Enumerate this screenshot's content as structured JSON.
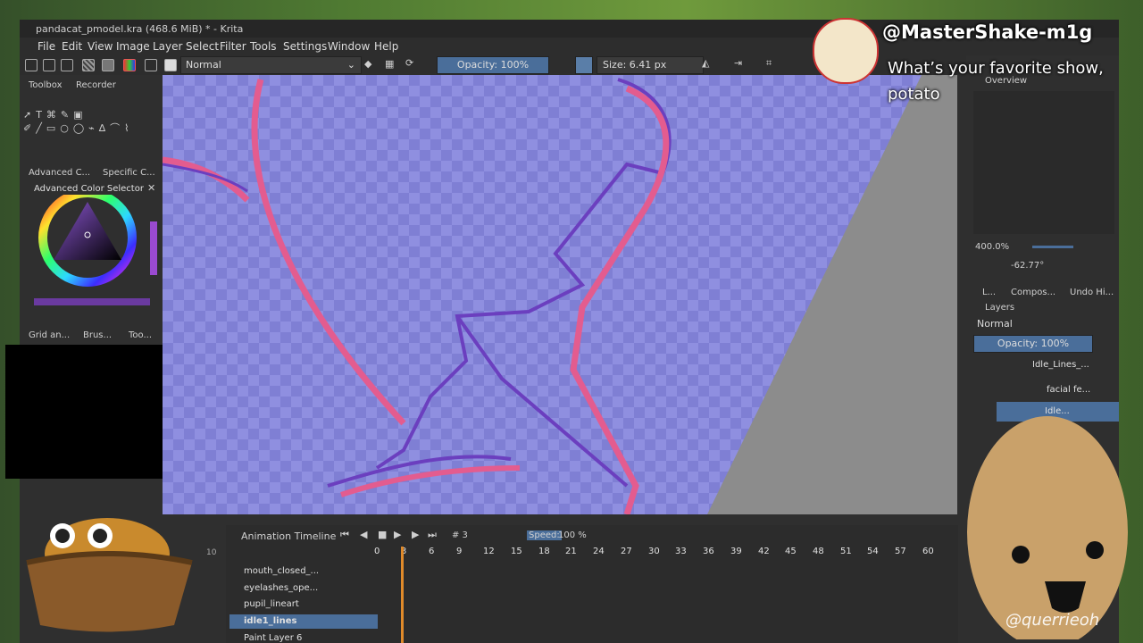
{
  "window": {
    "title": "pandacat_pmodel.kra (468.6 MiB) * - Krita"
  },
  "menu": [
    "File",
    "Edit",
    "View",
    "Image",
    "Layer",
    "Select",
    "Filter",
    "Tools",
    "Settings",
    "Window",
    "Help"
  ],
  "toolbar": {
    "blend_mode": "Normal",
    "opacity_label": "Opacity: 100%",
    "size_label": "Size: 6.41 px"
  },
  "left_dock": {
    "tabs": [
      "Toolbox",
      "Recorder"
    ],
    "color_tabs": [
      "Advanced C...",
      "Specific C..."
    ],
    "color_selector_title": "Advanced Color Selector",
    "bottom_tabs": [
      "Grid an...",
      "Brus...",
      "Too..."
    ]
  },
  "overview": {
    "title": "Overview",
    "zoom": "400.0%",
    "rotation": "-62.77°",
    "tabs": [
      "L...",
      "Compos...",
      "Undo Hi..."
    ]
  },
  "layers": {
    "title": "Layers",
    "blend_mode": "Normal",
    "opacity_label": "Opacity: 100%",
    "items": [
      "Idle_Lines_...",
      "facial fe...",
      "Idle..."
    ]
  },
  "timeline": {
    "title": "Animation Timeline",
    "frame_label": "# 3",
    "speed_label": "Speed:",
    "speed_value": "100 %",
    "ruler": [
      "0",
      "3",
      "6",
      "9",
      "12",
      "15",
      "18",
      "21",
      "24",
      "27",
      "30",
      "33",
      "36",
      "39",
      "42",
      "45",
      "48",
      "51",
      "54",
      "57",
      "60"
    ],
    "layers": [
      "mouth_closed_...",
      "eyelashes_ope...",
      "pupil_lineart",
      "idle1_lines",
      "Paint Layer 6"
    ]
  },
  "stream_overlay": {
    "chat_user": "@MasterShake-m1g",
    "chat_message": "What’s your favorite show, potato",
    "watermark": "@querrieoh",
    "left_tag": "10"
  },
  "colors": {
    "accent": "#4a6e9a",
    "stroke_pink": "#e35c8f",
    "stroke_purple": "#6b3fbf"
  }
}
